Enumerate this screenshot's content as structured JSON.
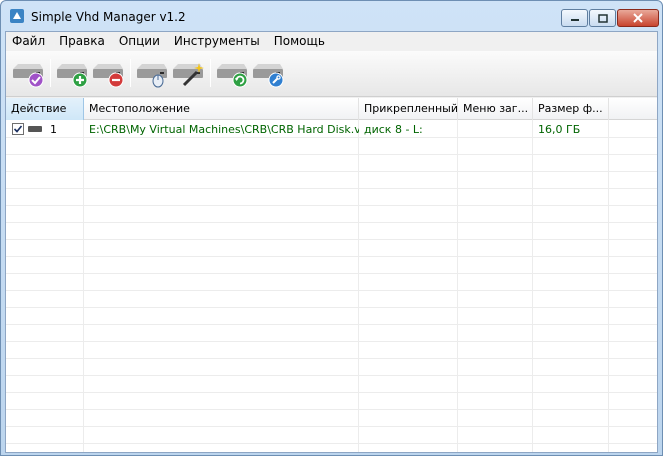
{
  "window": {
    "title": "Simple Vhd Manager v1.2"
  },
  "menu": [
    "Файл",
    "Правка",
    "Опции",
    "Инструменты",
    "Помощь"
  ],
  "toolbar_icons": [
    "drive-check-icon",
    "drive-add-icon",
    "drive-remove-icon",
    "drive-mouse-icon",
    "drive-wand-icon",
    "drive-refresh-icon",
    "drive-settings-icon"
  ],
  "columns": [
    "Действие",
    "Местоположение",
    "Прикрепленный",
    "Меню заг...",
    "Размер ф..."
  ],
  "rows": [
    {
      "checked": true,
      "num": "1",
      "location": "E:\\CRB\\My Virtual Machines\\CRB\\CRB Hard Disk.vhd",
      "attached": "диск 8  -  L:",
      "boot_menu": "",
      "size": "16,0 ГБ"
    }
  ],
  "colors": {
    "row_text": "#006400",
    "accent": "#3b84c4"
  }
}
